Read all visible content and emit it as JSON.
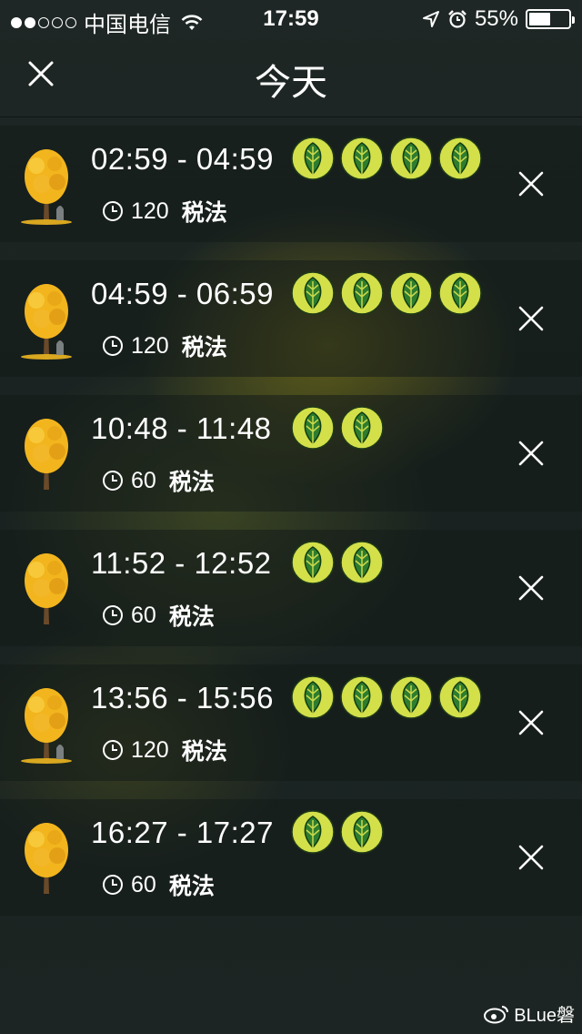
{
  "status_bar": {
    "carrier": "中国电信",
    "time": "17:59",
    "battery": "55%",
    "battery_level": 0.55,
    "signal_icon": "signal-dots-icon",
    "wifi_icon": "wifi-icon",
    "location_icon": "location-arrow-icon",
    "alarm_icon": "alarm-clock-icon"
  },
  "header": {
    "title": "今天",
    "close_icon": "close-icon"
  },
  "colors": {
    "leaf_badge": "#d3e04a",
    "leaf_green": "#2e7d2e",
    "tree_yellow": "#f2b51e"
  },
  "sessions": [
    {
      "time": "02:59 - 04:59",
      "duration": "120",
      "tag": "税法",
      "leaves": 4
    },
    {
      "time": "04:59 - 06:59",
      "duration": "120",
      "tag": "税法",
      "leaves": 4
    },
    {
      "time": "10:48 - 11:48",
      "duration": "60",
      "tag": "税法",
      "leaves": 2
    },
    {
      "time": "11:52 - 12:52",
      "duration": "60",
      "tag": "税法",
      "leaves": 2
    },
    {
      "time": "13:56 - 15:56",
      "duration": "120",
      "tag": "税法",
      "leaves": 4
    },
    {
      "time": "16:27 - 17:27",
      "duration": "60",
      "tag": "税法",
      "leaves": 2
    }
  ],
  "watermark": "BLue磐"
}
